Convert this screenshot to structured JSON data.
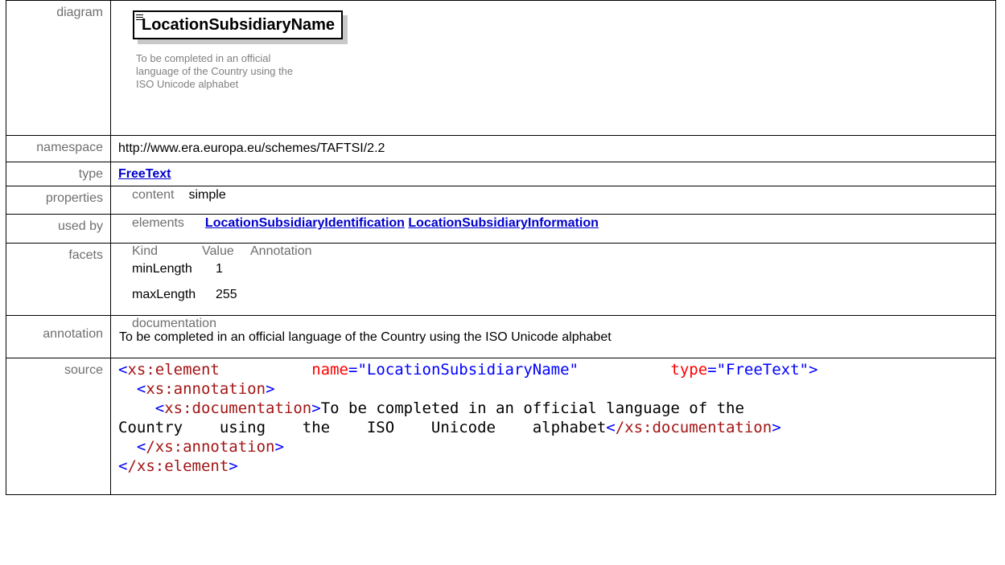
{
  "labels": {
    "diagram": "diagram",
    "namespace": "namespace",
    "type": "type",
    "properties": "properties",
    "used_by": "used by",
    "facets": "facets",
    "annotation": "annotation",
    "source": "source"
  },
  "diagram": {
    "element_name": "LocationSubsidiaryName",
    "doc_line1": "To be completed in an official",
    "doc_line2": "language of the Country using the",
    "doc_line3": "ISO Unicode alphabet"
  },
  "namespace": "http://www.era.europa.eu/schemes/TAFTSI/2.2",
  "type_link": "FreeText",
  "properties": {
    "key": "content",
    "value": "simple"
  },
  "used_by": {
    "key": "elements",
    "links": [
      "LocationSubsidiaryIdentification",
      "LocationSubsidiaryInformation"
    ]
  },
  "facets": {
    "headers": [
      "Kind",
      "Value",
      "Annotation"
    ],
    "rows": [
      {
        "kind": "minLength",
        "value": "1"
      },
      {
        "kind": "maxLength",
        "value": "255"
      }
    ]
  },
  "annotation": {
    "key": "documentation",
    "text": "To be completed in an official language of the Country using the ISO Unicode alphabet"
  },
  "source": {
    "open_tag": "xs:element",
    "name_attr": "name",
    "name_val": "\"LocationSubsidiaryName\"",
    "type_attr": "type",
    "type_val": "\"FreeText\"",
    "ann_tag": "xs:annotation",
    "doc_tag": "xs:documentation",
    "doc_text_1": "To be completed in an official language of the",
    "doc_text_2": "Country    using    the    ISO    Unicode    alphabet",
    "ann_close": "/xs:annotation",
    "doc_close": "/xs:documentation",
    "close_tag": "/xs:element"
  }
}
